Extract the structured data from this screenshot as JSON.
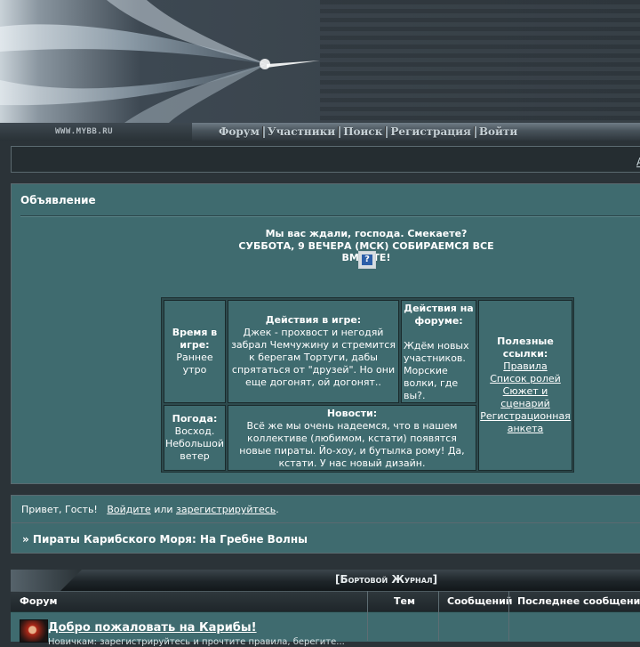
{
  "header": {
    "brand": "WWW.MYBB.RU",
    "nav": [
      "Форум",
      "Участники",
      "Поиск",
      "Регистрация",
      "Войти"
    ],
    "top_edge_letter": "А"
  },
  "announcement": {
    "title": "Объявление",
    "line1": "Мы вас ждали, господа. Смекаете?",
    "line2": "СУББОТА, 9 ВЕЧЕРА (МСК) СОБИРАЕМСЯ ВСЕ ВМЕСТЕ!",
    "broken_image_icon": "?",
    "table": {
      "time_heading": "Время в игре:",
      "time_value": "Раннее утро",
      "game_heading": "Действия в игре:",
      "game_text": "Джек - прохвост и негодяй забрал Чемчужину и стремится к берегам Тортуги, дабы спрятаться от \"друзей\". Но они еще догонят, ой догонят..",
      "forum_heading": "Действия на форуме:",
      "forum_text": "Ждём новых участников. Морские волки, где вы?.",
      "links_heading": "Полезные ссылки:",
      "links": [
        "Правила",
        "Список ролей",
        "Сюжет и сценарий",
        "Регистрационная анкета"
      ],
      "weather_heading": "Погода:",
      "weather_value": "Восход. Небольшой ветер",
      "news_heading": "Новости:",
      "news_text": "Всё же мы очень надеемся, что в нашем коллективе (любимом, кстати) появятся новые пираты. Йо-хоу, и бутылка рому! Да, кстати. У нас новый дизайн."
    }
  },
  "greeting": {
    "prefix": "Привет, Гость!",
    "login": "Войдите",
    "or": "или",
    "register": "зарегистрируйтесь",
    "suffix": "."
  },
  "breadcrumb": "» Пираты Карибского Моря: На Гребне Волны",
  "category": {
    "title": "[Бортовой Журнал]",
    "columns": {
      "forum": "Форум",
      "topics": "Тем",
      "posts": "Сообщений",
      "last": "Последнее сообщение"
    },
    "rows": [
      {
        "title": "Добро пожаловать на Карибы!",
        "description": "Новичкам: зарегистрируйтесь и прочтите правила, берегите..."
      }
    ]
  },
  "colors": {
    "panel_teal": "#3f6b6f",
    "background": "#2b3338",
    "border": "#5b6a70"
  }
}
